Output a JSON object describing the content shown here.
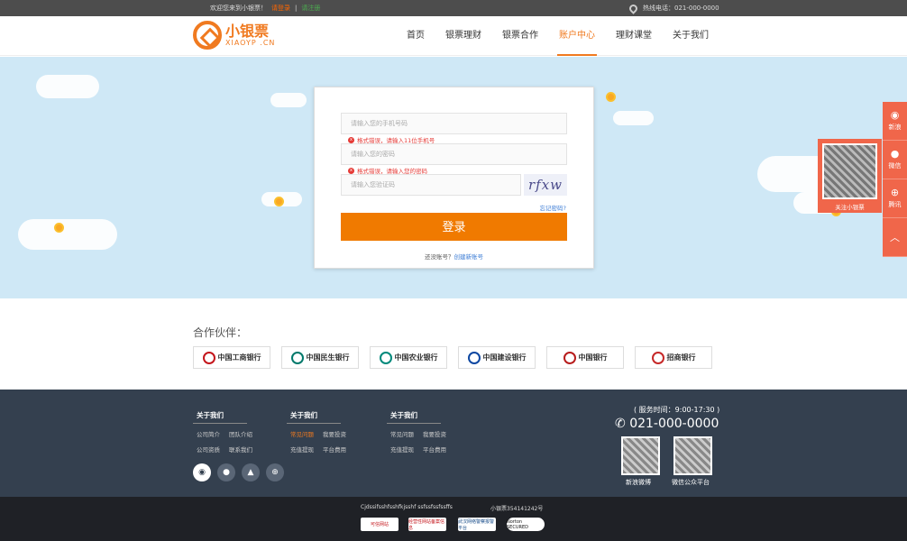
{
  "topbar": {
    "welcome": "欢迎您来到小银票！",
    "login_link": "请登录",
    "separator": "|",
    "register_link": "请注册",
    "hotline": "热线电话：021-000-0000"
  },
  "logo": {
    "cn": "小银票",
    "en": "XIAOYP .CN"
  },
  "nav": [
    {
      "label": "首页"
    },
    {
      "label": "银票理财"
    },
    {
      "label": "银票合作"
    },
    {
      "label": "账户中心",
      "active": true
    },
    {
      "label": "理财课堂"
    },
    {
      "label": "关于我们"
    }
  ],
  "login": {
    "phone_placeholder": "请输入您的手机号码",
    "phone_error": "格式错误，请输入11位手机号",
    "password_placeholder": "请输入您的密码",
    "password_error": "格式错误，请输入您的密码",
    "captcha_placeholder": "请输入您验证码",
    "captcha_text": "rfxw",
    "forgot": "忘记密码?",
    "button": "登录",
    "no_account": "还没账号？",
    "create": "创建新账号"
  },
  "sidebar": {
    "weibo": "新浪",
    "wechat": "微信",
    "tencent": "腾讯",
    "qr_label": "关注小银票"
  },
  "partners": {
    "title": "合作伙伴：",
    "banks": [
      {
        "name": "中国工商银行",
        "color": "#c4161c"
      },
      {
        "name": "中国民生银行",
        "color": "#00796b"
      },
      {
        "name": "中国农业银行",
        "color": "#00897b"
      },
      {
        "name": "中国建设银行",
        "color": "#0d47a1"
      },
      {
        "name": "中国银行",
        "color": "#b71c1c"
      },
      {
        "name": "招商银行",
        "color": "#c62828"
      }
    ]
  },
  "footer": {
    "col1": {
      "title": "关于我们",
      "rows": [
        [
          "公司简介",
          "团队介绍"
        ],
        [
          "公司资质",
          "联系我们"
        ]
      ]
    },
    "col2": {
      "title": "关于我们",
      "rows": [
        [
          "常见问题",
          "我要投资"
        ],
        [
          "充值提现",
          "平台费用"
        ]
      ]
    },
    "col3": {
      "title": "关于我们",
      "rows": [
        [
          "常见问题",
          "我要投资"
        ],
        [
          "充值提现",
          "平台费用"
        ]
      ]
    },
    "service_time": "( 服务时间：9:00-17:30 )",
    "hotline": "021-000-0000",
    "qr1": "新浪微博",
    "qr2": "微信公众平台"
  },
  "bottom": {
    "text1": "Cjdssifsshfsshfkjsshf ssfssfssfssffs",
    "icp": "小银票354141242号",
    "badges": [
      "可信网站",
      "经营性网站备案信息",
      "武汉网络警察报警平台",
      "Norton SECURED"
    ]
  }
}
